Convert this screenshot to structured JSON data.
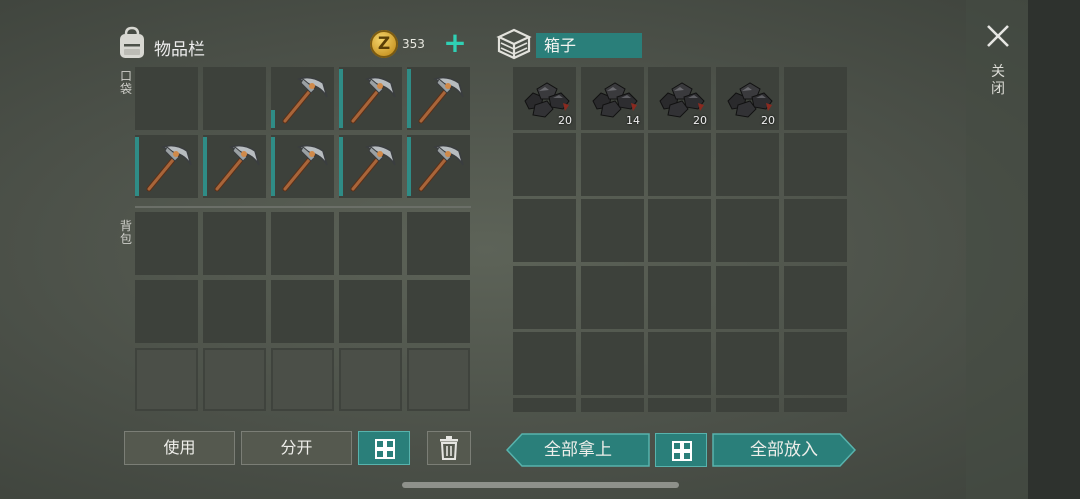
{
  "inventory": {
    "title": "物品栏",
    "coins": "353",
    "pocket_label": "口袋",
    "backpack_label": "背包",
    "pocket_slots": [
      {
        "item": "",
        "count": ""
      },
      {
        "item": "",
        "count": ""
      },
      {
        "item": "pickaxe",
        "count": "",
        "durability": 0.3
      },
      {
        "item": "pickaxe",
        "count": "",
        "durability": 1.0
      },
      {
        "item": "pickaxe",
        "count": "",
        "durability": 1.0
      },
      {
        "item": "pickaxe",
        "count": "",
        "durability": 1.0
      },
      {
        "item": "pickaxe",
        "count": "",
        "durability": 1.0
      },
      {
        "item": "pickaxe",
        "count": "",
        "durability": 1.0
      },
      {
        "item": "pickaxe",
        "count": "",
        "durability": 1.0
      },
      {
        "item": "pickaxe",
        "count": "",
        "durability": 1.0
      }
    ],
    "buttons": {
      "use": "使用",
      "split": "分开"
    }
  },
  "chest": {
    "title": "箱子",
    "slots": [
      {
        "item": "coal",
        "count": "20"
      },
      {
        "item": "coal",
        "count": "14"
      },
      {
        "item": "coal",
        "count": "20"
      },
      {
        "item": "coal",
        "count": "20"
      }
    ],
    "buttons": {
      "take_all": "全部拿上",
      "put_all": "全部放入"
    }
  },
  "close_label": "关闭",
  "colors": {
    "accent": "#2a7f7a",
    "plus": "#2fd0b4",
    "coin": "#d8a93a"
  },
  "icons": [
    "backpack-icon",
    "coin-icon",
    "plus-icon",
    "box-icon",
    "pickaxe-icon",
    "coal-icon",
    "grid-icon",
    "trash-icon",
    "close-icon"
  ]
}
